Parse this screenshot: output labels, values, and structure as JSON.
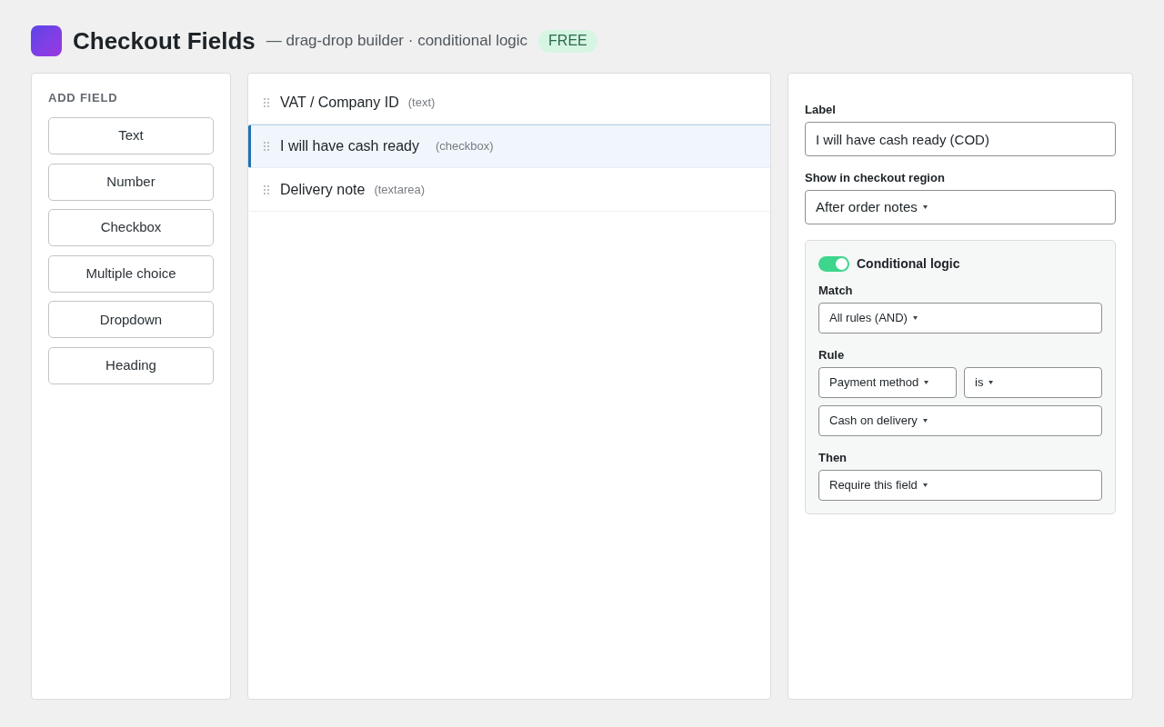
{
  "header": {
    "title": "Checkout Fields",
    "subtitle": "— drag-drop builder · conditional logic",
    "badge": "FREE"
  },
  "palette": {
    "heading": "ADD FIELD",
    "buttons": [
      "Text",
      "Number",
      "Checkbox",
      "Multiple choice",
      "Dropdown",
      "Heading"
    ]
  },
  "fields": [
    {
      "label": "VAT / Company ID",
      "type": "(text)",
      "selected": false
    },
    {
      "label": "I will have cash ready",
      "type": "(checkbox)",
      "selected": true
    },
    {
      "label": "Delivery note",
      "type": "(textarea)",
      "selected": false
    }
  ],
  "settings": {
    "label_field": {
      "label": "Label",
      "value": "I will have cash ready (COD)"
    },
    "region": {
      "label": "Show in checkout region",
      "value": "After order notes"
    },
    "conditional": {
      "title": "Conditional logic",
      "on": true,
      "match": {
        "label": "Match",
        "value": "All rules (AND)"
      },
      "rule": {
        "label": "Rule",
        "field": "Payment method",
        "operator": "is",
        "value": "Cash on delivery"
      },
      "then": {
        "label": "Then",
        "value": "Require this field"
      }
    }
  }
}
